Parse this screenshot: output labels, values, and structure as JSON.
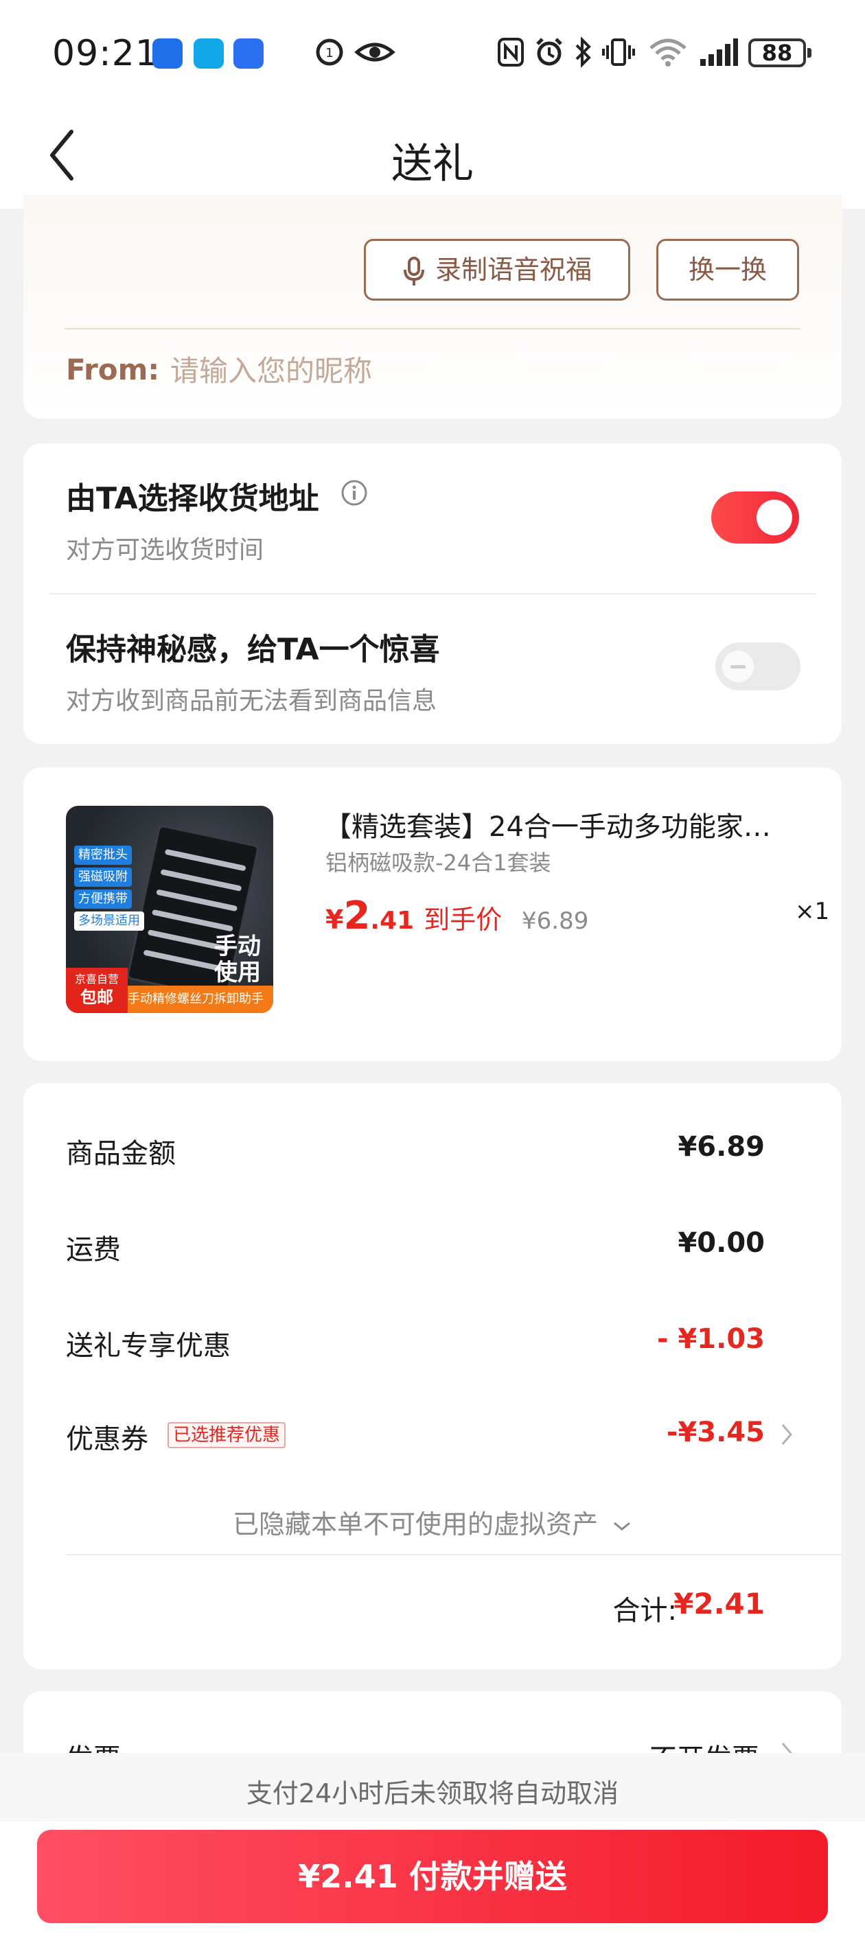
{
  "status_bar": {
    "time": "09:21",
    "battery": "88"
  },
  "header": {
    "title": "送礼"
  },
  "greeting": {
    "voice_button": "录制语音祝福",
    "swap_button": "换一换",
    "from_label": "From:",
    "from_placeholder": "请输入您的昵称"
  },
  "options": {
    "address_title": "由TA选择收货地址",
    "address_sub": "对方可选收货时间",
    "address_enabled": true,
    "mystery_title": "保持神秘感，给TA一个惊喜",
    "mystery_sub": "对方收到商品前无法看到商品信息",
    "mystery_enabled": false
  },
  "product": {
    "title": "【精选套装】24合一手动多功能家…",
    "spec": "铝柄磁吸款-24合1套装",
    "price_symbol": "¥",
    "price_int": "2",
    "price_dec": ".41",
    "price_label": "到手价",
    "orig_price": "¥6.89",
    "qty": "×1",
    "image_tags": [
      "精密批头",
      "强磁吸附",
      "方便携带",
      "多场景适用"
    ],
    "image_use": "手动\n使用",
    "image_bottom": "手动精修螺丝刀拆卸助手",
    "image_jd_line1": "京喜自营",
    "image_jd_line2": "包邮"
  },
  "summary": {
    "goods_label": "商品金额",
    "goods_value": "¥6.89",
    "shipping_label": "运费",
    "shipping_value": "¥0.00",
    "gift_discount_label": "送礼专享优惠",
    "gift_discount_value": "- ¥1.03",
    "coupon_label": "优惠券",
    "coupon_tag": "已选推荐优惠",
    "coupon_value": "-¥3.45",
    "hidden_assets": "已隐藏本单不可使用的虚拟资产",
    "total_label": "合计:",
    "total_value": "¥2.41"
  },
  "invoice": {
    "label": "发票",
    "value": "不开发票"
  },
  "footer": {
    "note": "支付24小时后未领取将自动取消",
    "pay_button": "¥2.41 付款并赠送"
  },
  "colors": {
    "accent_red": "#e6261f",
    "gold_brown": "#9a6a52",
    "pay_gradient_start": "#ff4f63",
    "pay_gradient_end": "#f31b2a"
  }
}
